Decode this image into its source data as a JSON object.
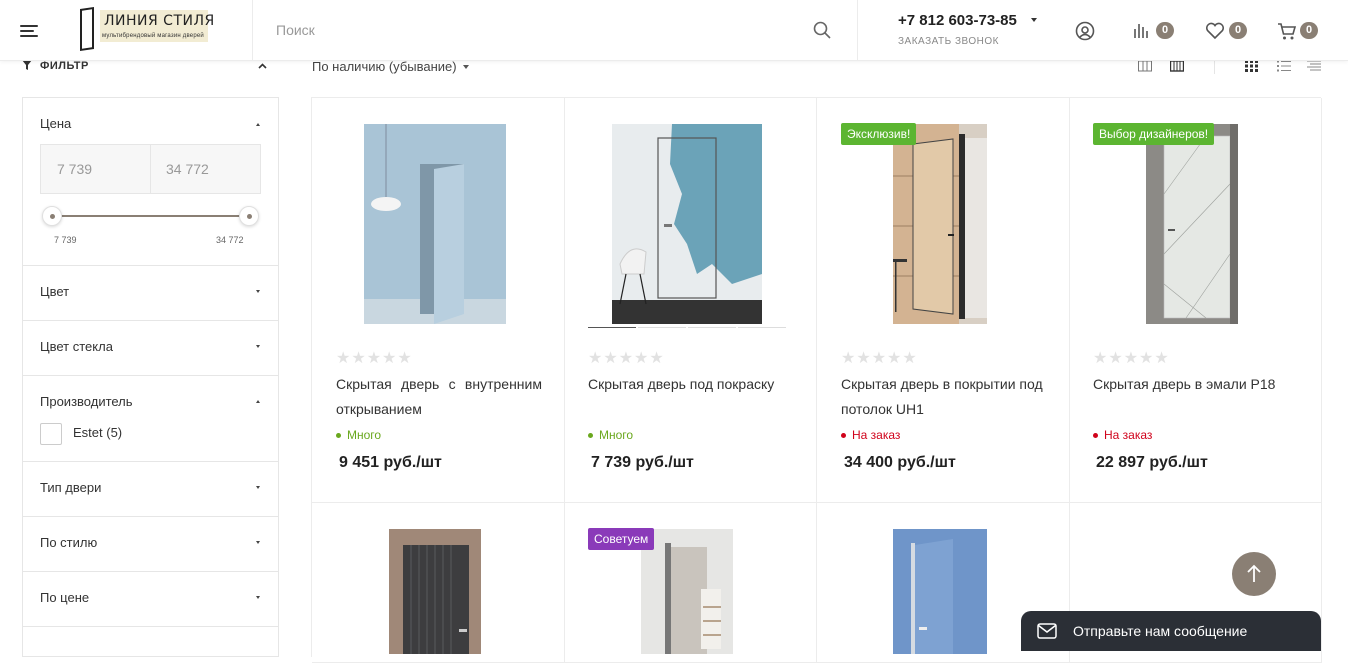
{
  "header": {
    "logo_title": "ЛИНИЯ СТИЛЯ",
    "logo_subtitle": "мультибрендовый магазин дверей",
    "search_placeholder": "Поиск",
    "phone": "+7 812 603-73-85",
    "callback": "ЗАКАЗАТЬ ЗВОНОК",
    "compare_count": "0",
    "favorites_count": "0",
    "cart_count": "0"
  },
  "toolbar": {
    "filter_label": "ФИЛЬТР",
    "sort_label": "По наличию (убывание)"
  },
  "filter": {
    "price": {
      "title": "Цена",
      "min_input": "7 739",
      "max_input": "34 772",
      "min_label": "7 739",
      "max_label": "34 772"
    },
    "sections": [
      {
        "title": "Цвет"
      },
      {
        "title": "Цвет стекла"
      }
    ],
    "manufacturer": {
      "title": "Производитель",
      "option": "Estet (5)"
    },
    "sections2": [
      {
        "title": "Тип двери"
      },
      {
        "title": "По стилю"
      },
      {
        "title": "По цене"
      }
    ]
  },
  "products": [
    {
      "name": "Скрытая дверь с внутренним открыванием",
      "stock": "Много",
      "stock_color": "#6aa81e",
      "price": "9 451 руб./шт",
      "sticker": ""
    },
    {
      "name": "Скрытая дверь под покраску",
      "stock": "Много",
      "stock_color": "#6aa81e",
      "price": "7 739 руб./шт",
      "sticker": ""
    },
    {
      "name": "Скрытая дверь в покрытии под потолок UH1",
      "stock": "На заказ",
      "stock_color": "#d0021b",
      "price": "34 400 руб./шт",
      "sticker": "Эксклюзив!",
      "sticker_color": "#5cb531"
    },
    {
      "name": "Скрытая дверь в эмали Р18",
      "stock": "На заказ",
      "stock_color": "#d0021b",
      "price": "22 897 руб./шт",
      "sticker": "Выбор дизайнеров!",
      "sticker_color": "#5cb531"
    }
  ],
  "products_row2": [
    {
      "sticker": ""
    },
    {
      "sticker": "Советуем",
      "sticker_color": "#8a3ab9"
    },
    {
      "sticker": ""
    }
  ],
  "chat": {
    "label": "Отправьте нам сообщение"
  },
  "colors": {
    "accent": "#8a7f74"
  }
}
